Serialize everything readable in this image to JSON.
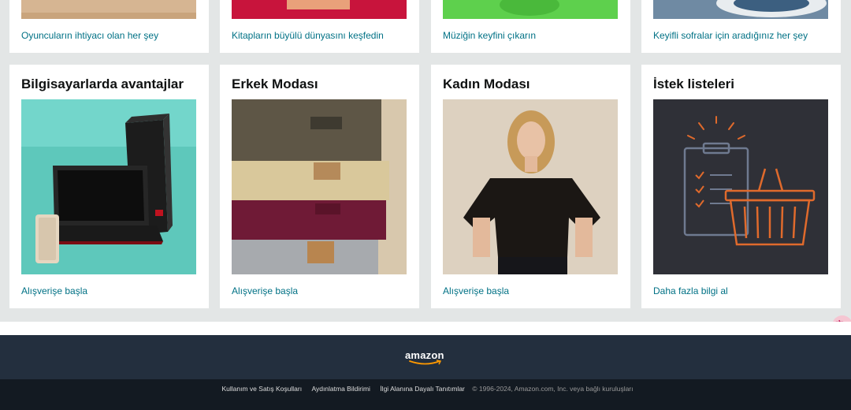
{
  "top_row": [
    {
      "link": "Oyuncuların ihtiyacı olan her şey"
    },
    {
      "link": "Kitapların büyülü dünyasını keşfedin"
    },
    {
      "link": "Müziğin keyfini çıkarın"
    },
    {
      "link": "Keyifli sofralar için aradığınız her şey"
    }
  ],
  "cards": [
    {
      "title": "Bilgisayarlarda avantajlar",
      "link": "Alışverişe başla"
    },
    {
      "title": "Erkek Modası",
      "link": "Alışverişe başla"
    },
    {
      "title": "Kadın Modası",
      "link": "Alışverişe başla"
    },
    {
      "title": "İstek listeleri",
      "link": "Daha fazla bilgi al"
    }
  ],
  "footer": {
    "logo_text": "amazon",
    "links": [
      "Kullanım ve Satış Koşulları",
      "Aydınlatma Bildirimi",
      "İlgi Alanına Dayalı Tanıtımlar"
    ],
    "copyright": "© 1996-2024, Amazon.com, Inc. veya bağlı kuruluşları"
  },
  "translate_icon": "translate-icon",
  "colors": {
    "page_bg": "#e3e6e6",
    "link": "#007185",
    "footer_top": "#232f3e",
    "footer_bottom": "#131a22",
    "accent": "#ff9900"
  }
}
